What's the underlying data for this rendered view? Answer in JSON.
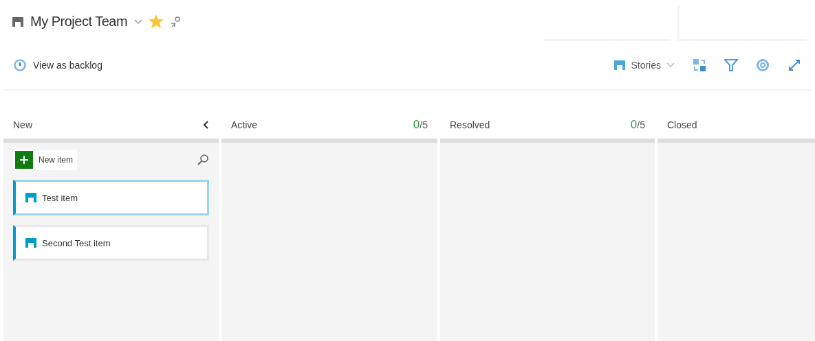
{
  "header": {
    "title": "My Project Team",
    "favorite": true
  },
  "toolbar": {
    "backlog_link": "View as backlog",
    "backlog_level": "Stories"
  },
  "columns": [
    {
      "name": "New",
      "collapsible": true,
      "new_item": "New item",
      "items": [
        {
          "title": "Test item",
          "selected": true
        },
        {
          "title": "Second Test item",
          "selected": false
        }
      ]
    },
    {
      "name": "Active",
      "count": "0",
      "limit": "/5"
    },
    {
      "name": "Resolved",
      "count": "0",
      "limit": "/5"
    },
    {
      "name": "Closed"
    }
  ]
}
